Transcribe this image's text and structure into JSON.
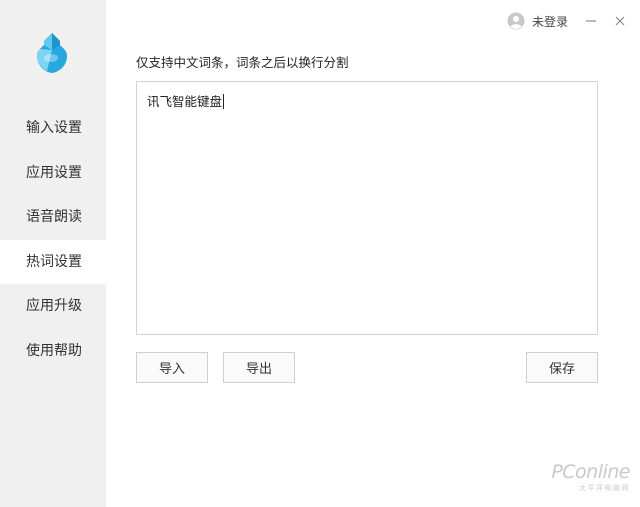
{
  "titlebar": {
    "user_label": "未登录"
  },
  "sidebar": {
    "items": [
      {
        "label": "输入设置",
        "active": false
      },
      {
        "label": "应用设置",
        "active": false
      },
      {
        "label": "语音朗读",
        "active": false
      },
      {
        "label": "热词设置",
        "active": true
      },
      {
        "label": "应用升级",
        "active": false
      },
      {
        "label": "使用帮助",
        "active": false
      }
    ]
  },
  "main": {
    "instruction": "仅支持中文词条，词条之后以换行分割",
    "editor_value": "讯飞智能键盘",
    "buttons": {
      "import_label": "导入",
      "export_label": "导出",
      "save_label": "保存"
    }
  },
  "watermark": {
    "main": "PConline",
    "sub": "太平洋电脑网"
  },
  "colors": {
    "sidebar_bg": "#f0f0f0",
    "logo_primary": "#29a8e0",
    "logo_light": "#7fd3f5"
  },
  "icons": [
    "app-logo-icon",
    "user-avatar-icon",
    "minimize-icon",
    "close-icon"
  ]
}
